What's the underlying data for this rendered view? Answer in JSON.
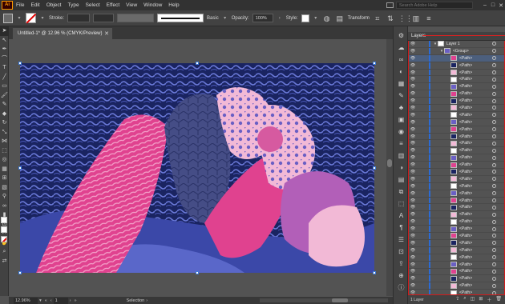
{
  "app": {
    "logo": "Ai"
  },
  "menu": [
    "File",
    "Edit",
    "Object",
    "Type",
    "Select",
    "Effect",
    "View",
    "Window",
    "Help"
  ],
  "search": {
    "placeholder": "Search Adobe Help"
  },
  "window_controls": [
    "–",
    "□",
    "✕"
  ],
  "control_bar": {
    "stroke_label": "Stroke:",
    "brush_label": "Basic",
    "opacity_label": "Opacity:",
    "opacity_value": "100%",
    "style_label": "Style:",
    "transform_label": "Transform"
  },
  "document": {
    "tab_title": "Untitled-1* @ 12.96 % (CMYK/Preview)",
    "close": "✕"
  },
  "status": {
    "zoom": "12.96%",
    "page": "1",
    "tool": "Selection"
  },
  "layers": {
    "title": "Layers",
    "footer_count": "1 Layer",
    "rows": [
      {
        "name": "Layer 1",
        "toggle": "▾",
        "level": 0,
        "selected": false
      },
      {
        "name": "<Group>",
        "toggle": "▾",
        "level": 1,
        "selected": false
      },
      {
        "name": "<Path>",
        "toggle": "",
        "level": 2,
        "selected": true
      },
      {
        "name": "<Path>",
        "toggle": "",
        "level": 2,
        "selected": false
      },
      {
        "name": "<Path>",
        "toggle": "",
        "level": 2,
        "selected": false
      },
      {
        "name": "<Path>",
        "toggle": "",
        "level": 2,
        "selected": false
      },
      {
        "name": "<Path>",
        "toggle": "",
        "level": 2,
        "selected": false
      },
      {
        "name": "<Path>",
        "toggle": "",
        "level": 2,
        "selected": false
      },
      {
        "name": "<Path>",
        "toggle": "",
        "level": 2,
        "selected": false
      },
      {
        "name": "<Path>",
        "toggle": "",
        "level": 2,
        "selected": false
      },
      {
        "name": "<Path>",
        "toggle": "",
        "level": 2,
        "selected": false
      },
      {
        "name": "<Path>",
        "toggle": "",
        "level": 2,
        "selected": false
      },
      {
        "name": "<Path>",
        "toggle": "",
        "level": 2,
        "selected": false
      },
      {
        "name": "<Path>",
        "toggle": "",
        "level": 2,
        "selected": false
      },
      {
        "name": "<Path>",
        "toggle": "",
        "level": 2,
        "selected": false
      },
      {
        "name": "<Path>",
        "toggle": "",
        "level": 2,
        "selected": false
      },
      {
        "name": "<Path>",
        "toggle": "",
        "level": 2,
        "selected": false
      },
      {
        "name": "<Path>",
        "toggle": "",
        "level": 2,
        "selected": false
      },
      {
        "name": "<Path>",
        "toggle": "",
        "level": 2,
        "selected": false
      },
      {
        "name": "<Path>",
        "toggle": "",
        "level": 2,
        "selected": false
      },
      {
        "name": "<Path>",
        "toggle": "",
        "level": 2,
        "selected": false
      },
      {
        "name": "<Path>",
        "toggle": "",
        "level": 2,
        "selected": false
      },
      {
        "name": "<Path>",
        "toggle": "",
        "level": 2,
        "selected": false
      },
      {
        "name": "<Path>",
        "toggle": "",
        "level": 2,
        "selected": false
      },
      {
        "name": "<Path>",
        "toggle": "",
        "level": 2,
        "selected": false
      },
      {
        "name": "<Path>",
        "toggle": "",
        "level": 2,
        "selected": false
      },
      {
        "name": "<Path>",
        "toggle": "",
        "level": 2,
        "selected": false
      },
      {
        "name": "<Path>",
        "toggle": "",
        "level": 2,
        "selected": false
      },
      {
        "name": "<Path>",
        "toggle": "",
        "level": 2,
        "selected": false
      },
      {
        "name": "<Path>",
        "toggle": "",
        "level": 2,
        "selected": false
      },
      {
        "name": "<Path>",
        "toggle": "",
        "level": 2,
        "selected": false
      },
      {
        "name": "<Path>",
        "toggle": "",
        "level": 2,
        "selected": false
      },
      {
        "name": "<Path>",
        "toggle": "",
        "level": 2,
        "selected": false
      },
      {
        "name": "<Path>",
        "toggle": "",
        "level": 2,
        "selected": false
      },
      {
        "name": "<Path>",
        "toggle": "",
        "level": 2,
        "selected": false
      },
      {
        "name": "<Path>",
        "toggle": "",
        "level": 2,
        "selected": false
      }
    ]
  },
  "colors": {
    "accent": "#2b6bd6",
    "highlight_red": "#e02020",
    "art_navy": "#1a2461",
    "art_blue": "#5a67c9",
    "art_pink": "#e0428f",
    "art_light_pink": "#f2b9d6"
  }
}
